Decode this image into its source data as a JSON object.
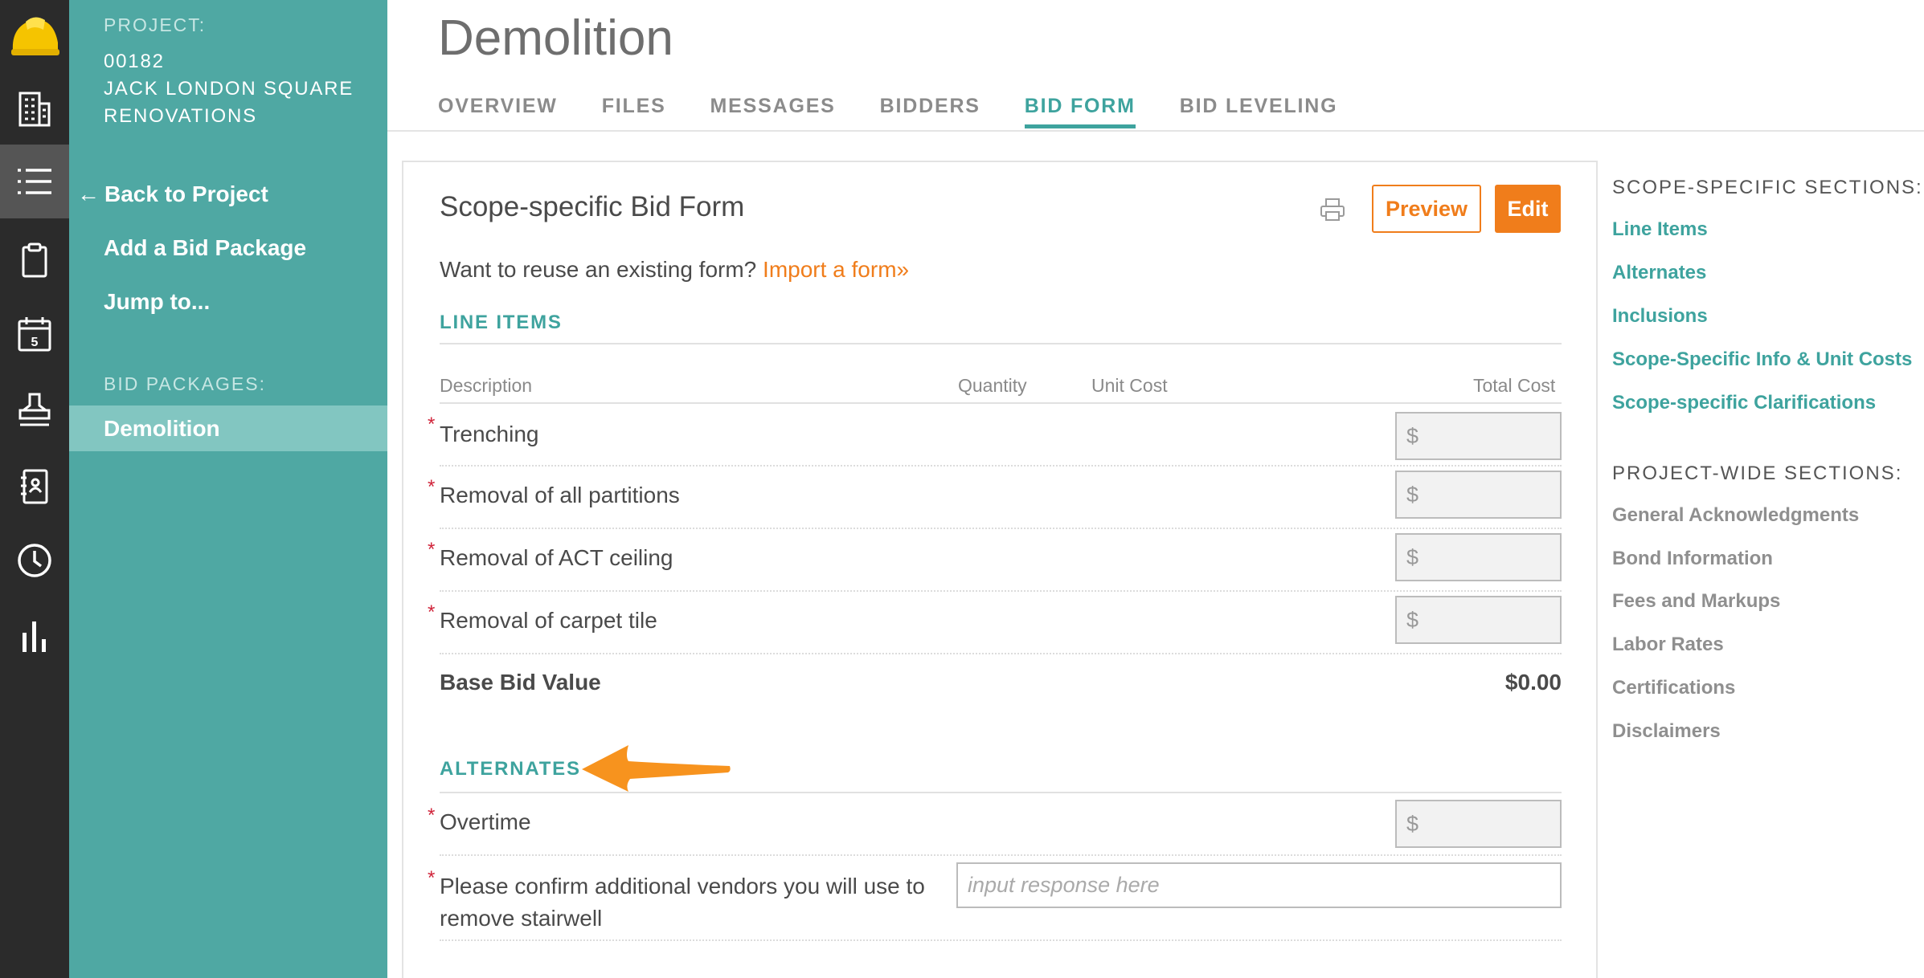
{
  "colors": {
    "teal": "#3ea39e",
    "sidebar": "#4fa8a3",
    "orange": "#f07d1b",
    "rail": "#2b2b2b",
    "required": "#d0243a"
  },
  "rail": {
    "icons": [
      "hardhat-logo-icon",
      "building-icon",
      "list-icon",
      "clipboard-icon",
      "calendar-icon",
      "stamp-icon",
      "address-book-icon",
      "clock-icon",
      "bar-chart-icon"
    ],
    "calendar_day": "5"
  },
  "sidebar": {
    "project_label": "PROJECT:",
    "project_number": "00182",
    "project_name": "JACK LONDON SQUARE RENOVATIONS",
    "back_arrow": "←",
    "back_label": "Back to Project",
    "add_label": "Add a Bid Package",
    "jump_label": "Jump to...",
    "packages_label": "BID PACKAGES:",
    "active_package": "Demolition"
  },
  "header": {
    "title": "Demolition",
    "tabs": [
      "OVERVIEW",
      "FILES",
      "MESSAGES",
      "BIDDERS",
      "BID FORM",
      "BID LEVELING"
    ],
    "active_tab": "BID FORM"
  },
  "form": {
    "title": "Scope-specific Bid Form",
    "preview_label": "Preview",
    "edit_label": "Edit",
    "reuse_text": "Want to reuse an existing form?",
    "import_link": "Import a form»",
    "line_items_heading": "LINE ITEMS",
    "columns": {
      "description": "Description",
      "quantity": "Quantity",
      "unit_cost": "Unit Cost",
      "total_cost": "Total Cost"
    },
    "required_mark": "*",
    "currency_symbol": "$",
    "line_items": [
      "Trenching",
      "Removal of all partitions",
      "Removal of ACT ceiling",
      "Removal of carpet tile"
    ],
    "base_bid_label": "Base Bid Value",
    "base_bid_value": "$0.00",
    "alternates_heading": "ALTERNATES",
    "alternates": [
      {
        "label": "Overtime"
      },
      {
        "label": "Please confirm additional vendors you will use to remove stairwell",
        "placeholder": "input response here"
      }
    ]
  },
  "right_nav": {
    "scope_heading": "SCOPE-SPECIFIC SECTIONS:",
    "scope_links": [
      "Line Items",
      "Alternates",
      "Inclusions",
      "Scope-Specific Info & Unit Costs",
      "Scope-specific Clarifications"
    ],
    "project_heading": "PROJECT-WIDE SECTIONS:",
    "project_links": [
      "General Acknowledgments",
      "Bond Information",
      "Fees and Markups",
      "Labor Rates",
      "Certifications",
      "Disclaimers"
    ]
  }
}
